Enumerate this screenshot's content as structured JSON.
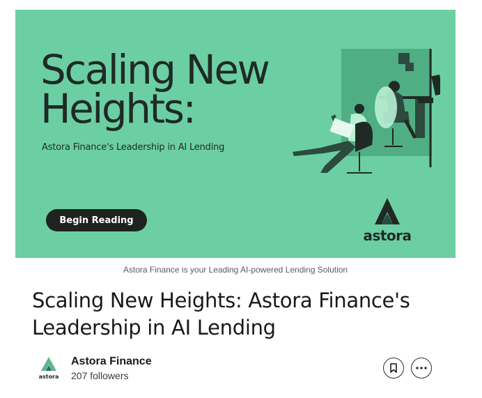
{
  "banner": {
    "headline": "Scaling New\nHeights:",
    "subheadline": "Astora Finance's Leadership in AI Lending",
    "cta_label": "Begin Reading",
    "brand_word": "astora",
    "background_color": "#6ccfa3"
  },
  "caption": "Astora Finance is your Leading AI-powered Lending Solution",
  "article": {
    "title": "Scaling New Heights: Astora Finance's Leadership in AI Lending"
  },
  "author": {
    "name": "Astora Finance",
    "followers": "207 followers",
    "avatar_word": "astora"
  },
  "actions": {
    "save_icon": "bookmark-icon",
    "more_icon": "more-horizontal-icon"
  }
}
